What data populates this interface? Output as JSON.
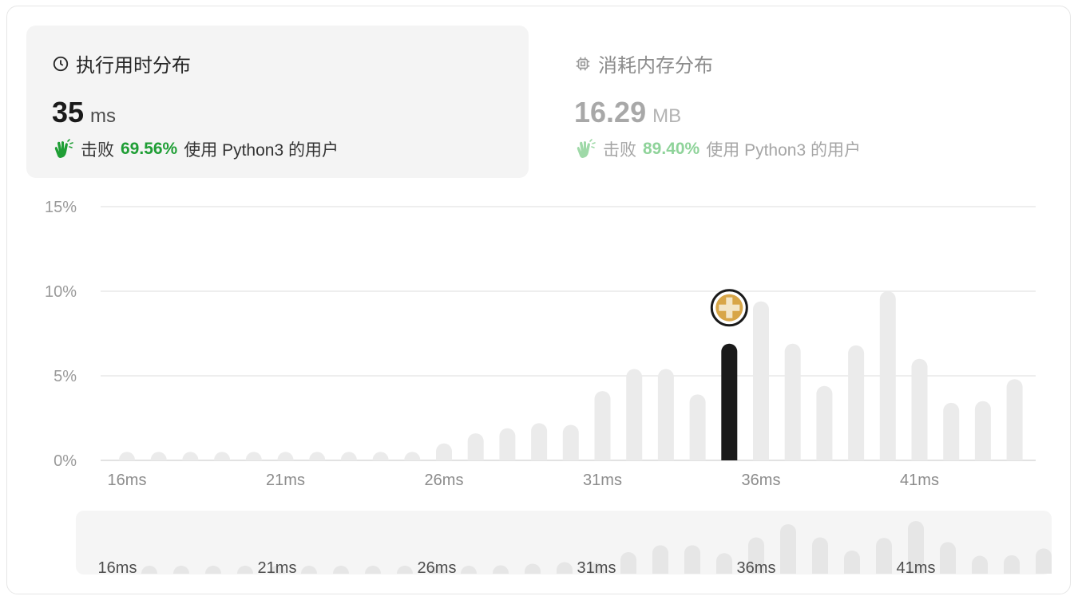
{
  "runtime": {
    "title": "执行用时分布",
    "value": "35",
    "unit": "ms",
    "beats_prefix": "击败",
    "beats_pct": "69.56%",
    "beats_suffix": "使用 Python3 的用户"
  },
  "memory": {
    "title": "消耗内存分布",
    "value": "16.29",
    "unit": "MB",
    "beats_prefix": "击败",
    "beats_pct": "89.40%",
    "beats_suffix": "使用 Python3 的用户"
  },
  "colors": {
    "accent_green": "#1f9e35",
    "bar_default": "#ebebeb",
    "bar_selected": "#1a1a1a"
  },
  "chart_data": {
    "type": "bar",
    "ylim": [
      0,
      15
    ],
    "y_ticks": [
      "0%",
      "5%",
      "10%",
      "15%"
    ],
    "x_tick_labels": [
      "16ms",
      "21ms",
      "26ms",
      "31ms",
      "36ms",
      "41ms"
    ],
    "categories": [
      16,
      17,
      18,
      19,
      20,
      21,
      22,
      23,
      24,
      25,
      26,
      27,
      28,
      29,
      30,
      31,
      32,
      33,
      34,
      35,
      36,
      37,
      38,
      39,
      40,
      41,
      42,
      43,
      44
    ],
    "values": [
      0.5,
      0.5,
      0.5,
      0.5,
      0.5,
      0.5,
      0.5,
      0.5,
      0.5,
      0.5,
      1.0,
      1.6,
      1.9,
      2.2,
      2.1,
      4.1,
      5.4,
      5.4,
      3.9,
      6.9,
      9.4,
      6.9,
      4.4,
      6.8,
      10.0,
      6.0,
      3.4,
      3.5,
      4.8
    ],
    "selected": 35,
    "grid": true
  },
  "overview": {
    "x_tick_labels": [
      "16ms",
      "21ms",
      "26ms",
      "31ms",
      "36ms",
      "41ms"
    ]
  }
}
